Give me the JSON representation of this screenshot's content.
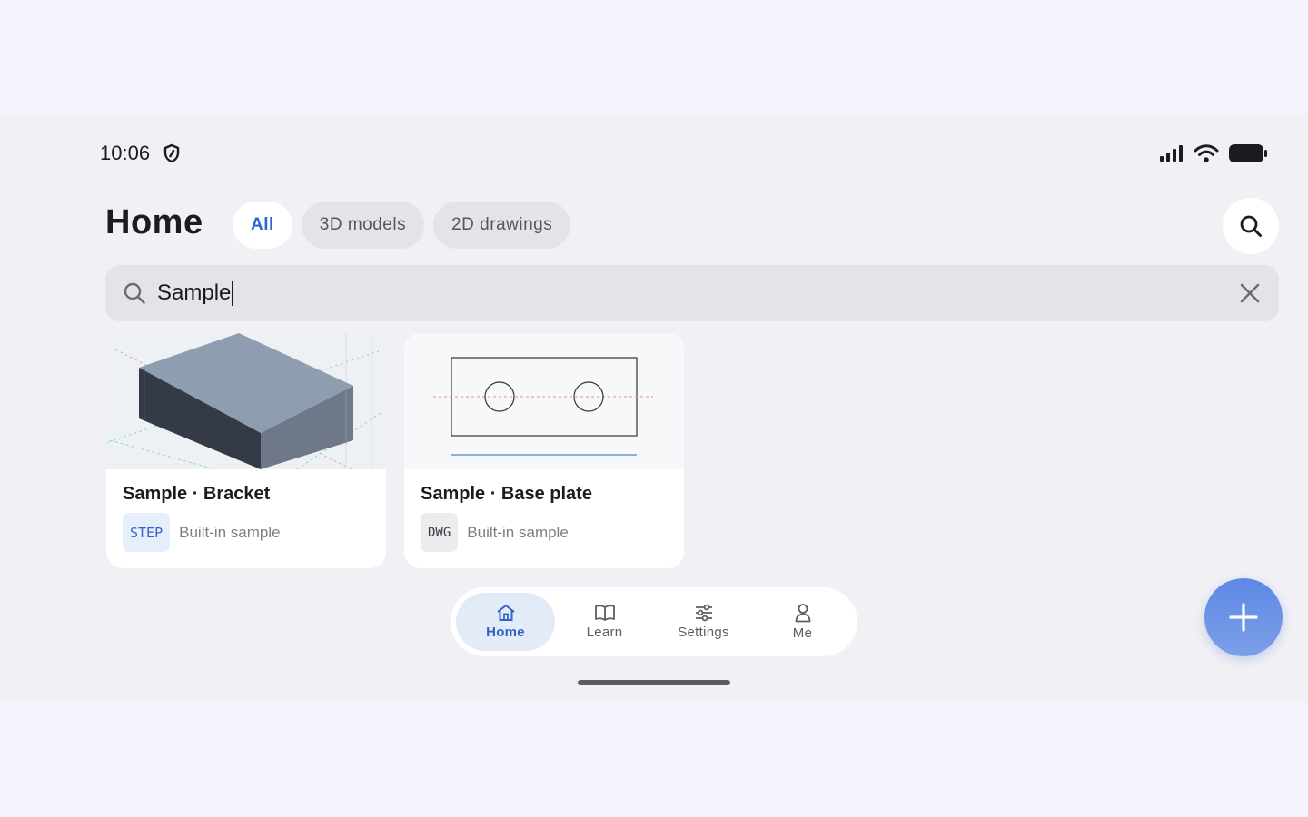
{
  "status_bar": {
    "time": "10:06"
  },
  "header": {
    "title": "Home",
    "filters": [
      {
        "label": "All",
        "active": true
      },
      {
        "label": "3D models",
        "active": false
      },
      {
        "label": "2D drawings",
        "active": false
      }
    ]
  },
  "search": {
    "value": "Sample"
  },
  "files": [
    {
      "title": "Sample · Bracket",
      "format": "STEP",
      "subtitle": "Built-in sample"
    },
    {
      "title": "Sample · Base plate",
      "format": "DWG",
      "subtitle": "Built-in sample"
    }
  ],
  "nav": {
    "items": [
      {
        "label": "Home",
        "icon": "home-icon",
        "active": true
      },
      {
        "label": "Learn",
        "icon": "book-icon",
        "active": false
      },
      {
        "label": "Settings",
        "icon": "sliders-icon",
        "active": false
      },
      {
        "label": "Me",
        "icon": "person-icon",
        "active": false
      }
    ]
  },
  "colors": {
    "accent": "#2f64c9",
    "fab": "#6a92e7",
    "background": "#f1f1f5"
  }
}
